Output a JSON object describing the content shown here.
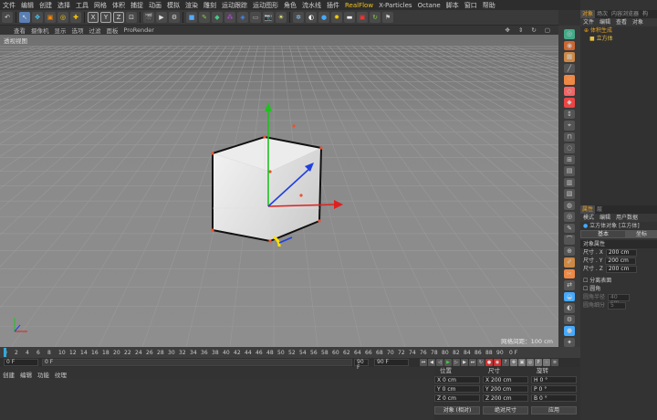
{
  "menubar": {
    "items": [
      "文件",
      "编辑",
      "创建",
      "选择",
      "工具",
      "网格",
      "体积",
      "捕捉",
      "动画",
      "模拟",
      "渲染",
      "雕刻",
      "运动跟踪",
      "运动图形",
      "角色",
      "流水线",
      "插件",
      "RealFlow",
      "X-Particles",
      "Octane",
      "脚本",
      "窗口",
      "帮助"
    ]
  },
  "viewport": {
    "menu": [
      "查看",
      "摄像机",
      "显示",
      "选项",
      "过滤",
      "面板",
      "ProRender"
    ],
    "label": "透视视图",
    "grid_spacing": "网格间距：100 cm"
  },
  "objects_panel": {
    "tabs": [
      "对象",
      "场次",
      "内容浏览器",
      "构"
    ],
    "menu": [
      "文件",
      "编辑",
      "查看",
      "对象"
    ],
    "rows": [
      {
        "name": "体积生成",
        "color": "#e8a020"
      },
      {
        "name": "立方体",
        "color": "#e8c040"
      }
    ]
  },
  "attr_panel": {
    "tabs": [
      "属性",
      "层"
    ],
    "menu": [
      "模式",
      "编辑",
      "用户数据"
    ],
    "object_title": "立方体对象 [立方体]",
    "subtabs": [
      "基本",
      "坐标"
    ],
    "section": "对象属性",
    "size_x_label": "尺寸 . X",
    "size_x": "200 cm",
    "size_y_label": "尺寸 . Y",
    "size_y": "200 cm",
    "size_z_label": "尺寸 . Z",
    "size_z": "200 cm",
    "sep_faces": "分离表面",
    "fillet": "圆角",
    "fillet_radius_label": "圆角半径",
    "fillet_radius": "40 cm",
    "fillet_sub_label": "圆角细分",
    "fillet_sub": "5"
  },
  "timeline": {
    "ticks": [
      "0",
      "2",
      "4",
      "6",
      "8",
      "10",
      "12",
      "14",
      "16",
      "18",
      "20",
      "22",
      "24",
      "26",
      "28",
      "30",
      "32",
      "34",
      "36",
      "38",
      "40",
      "42",
      "44",
      "46",
      "48",
      "50",
      "52",
      "54",
      "56",
      "58",
      "60",
      "62",
      "64",
      "66",
      "68",
      "70",
      "72",
      "74",
      "76",
      "78",
      "80",
      "82",
      "84",
      "86",
      "88",
      "90"
    ],
    "end_label": "0 F",
    "start_frame": "0 F",
    "current_frame": "0 F",
    "end_frame": "90 F",
    "max_frame": "90 F"
  },
  "material": {
    "menu": [
      "创建",
      "编辑",
      "功能",
      "纹理"
    ]
  },
  "coords": {
    "headers": [
      "位置",
      "尺寸",
      "旋转"
    ],
    "rows": [
      {
        "a": "X",
        "pos": "0 cm",
        "b": "X",
        "size": "200 cm",
        "c": "H",
        "rot": "0 °"
      },
      {
        "a": "Y",
        "pos": "0 cm",
        "b": "Y",
        "size": "200 cm",
        "c": "P",
        "rot": "0 °"
      },
      {
        "a": "Z",
        "pos": "0 cm",
        "b": "Z",
        "size": "200 cm",
        "c": "B",
        "rot": "0 °"
      }
    ],
    "mode_select": "对象 (相对)",
    "size_select": "绝对尺寸",
    "apply": "应用"
  },
  "colors": {
    "axis_x": "#e02020",
    "axis_y": "#20c020",
    "axis_z": "#2040e0",
    "accent": "#e8a020",
    "viewport_bg": "#8a8a8a"
  }
}
